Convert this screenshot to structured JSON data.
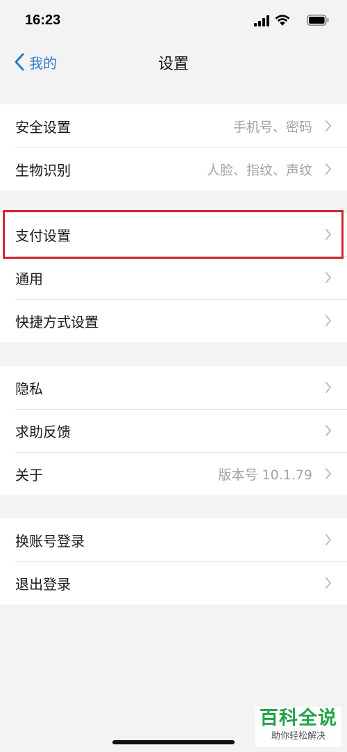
{
  "status_bar": {
    "time": "16:23"
  },
  "nav": {
    "back_label": "我的",
    "title": "设置"
  },
  "groups": [
    {
      "items": [
        {
          "label": "安全设置",
          "value": "手机号、密码"
        },
        {
          "label": "生物识别",
          "value": "人脸、指纹、声纹"
        }
      ]
    },
    {
      "items": [
        {
          "label": "支付设置",
          "value": ""
        },
        {
          "label": "通用",
          "value": ""
        },
        {
          "label": "快捷方式设置",
          "value": ""
        }
      ]
    },
    {
      "items": [
        {
          "label": "隐私",
          "value": ""
        },
        {
          "label": "求助反馈",
          "value": ""
        },
        {
          "label": "关于",
          "value": "版本号 10.1.79"
        }
      ]
    },
    {
      "items": [
        {
          "label": "换账号登录",
          "value": ""
        },
        {
          "label": "退出登录",
          "value": ""
        }
      ]
    }
  ],
  "watermark": {
    "main": "百科全说",
    "sub": "助你轻松解决"
  },
  "colors": {
    "accent": "#2a7ac5",
    "highlight_border": "#d0262f",
    "watermark_green": "#23a34a"
  }
}
